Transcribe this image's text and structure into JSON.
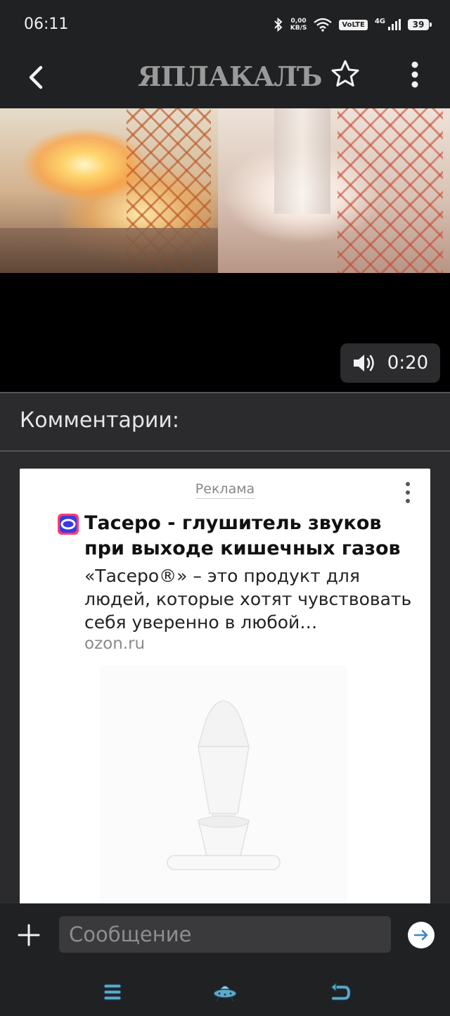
{
  "status_bar": {
    "time": "06:11",
    "net_speed_value": "0,00",
    "net_speed_unit": "KB/S",
    "volte": "VoLTE",
    "network": "4G",
    "battery": "39"
  },
  "header": {
    "logo_text": "ЯПЛАКАЛЪ",
    "back_icon": "chevron-left-icon",
    "favorite_icon": "star-outline-icon",
    "more_icon": "more-vertical-icon"
  },
  "video": {
    "duration": "0:20",
    "volume_icon": "speaker-icon"
  },
  "comments": {
    "title": "Комментарии:"
  },
  "ad": {
    "label": "Реклама",
    "title": "Тасеро - глушитель звуков при выходе кишечных газов",
    "description": "«Тасеро®» – это продукт для людей, которые хотят чувствовать себя уверенно в любой…",
    "domain": "ozon.ru",
    "menu_icon": "more-vertical-icon"
  },
  "composer": {
    "placeholder": "Сообщение",
    "add_icon": "plus-icon",
    "send_icon": "arrow-right-icon"
  },
  "bottom_nav": {
    "items": [
      "menu-icon",
      "ufo-icon",
      "undo-icon"
    ]
  },
  "colors": {
    "background": "#2b2b2e",
    "bar": "#202123",
    "ad_background": "#ffffff",
    "nav_icon": "#5fa8c8"
  }
}
